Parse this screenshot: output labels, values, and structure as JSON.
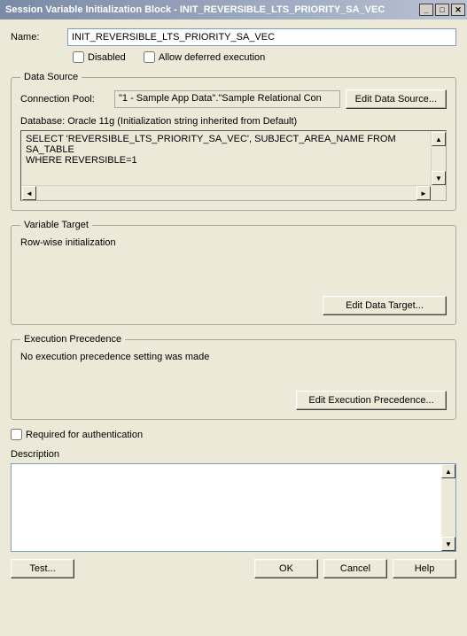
{
  "window": {
    "title": "Session Variable Initialization Block - INIT_REVERSIBLE_LTS_PRIORITY_SA_VEC"
  },
  "form": {
    "name_label": "Name:",
    "name_value": "INIT_REVERSIBLE_LTS_PRIORITY_SA_VEC",
    "disabled_label": "Disabled",
    "deferred_label": "Allow deferred execution"
  },
  "data_source": {
    "legend": "Data Source",
    "conn_pool_label": "Connection Pool:",
    "conn_pool_value": "\"1 - Sample App Data\".\"Sample Relational Con",
    "edit_btn": "Edit Data Source...",
    "db_label": "Database: Oracle 11g (Initialization string inherited from Default)",
    "sql": "SELECT 'REVERSIBLE_LTS_PRIORITY_SA_VEC', SUBJECT_AREA_NAME FROM SA_TABLE\nWHERE REVERSIBLE=1"
  },
  "variable_target": {
    "legend": "Variable Target",
    "body": "Row-wise initialization",
    "edit_btn": "Edit Data Target..."
  },
  "execution_precedence": {
    "legend": "Execution Precedence",
    "body": "No execution precedence setting was made",
    "edit_btn": "Edit Execution Precedence..."
  },
  "req_auth_label": "Required for authentication",
  "description_label": "Description",
  "buttons": {
    "test": "Test...",
    "ok": "OK",
    "cancel": "Cancel",
    "help": "Help"
  }
}
